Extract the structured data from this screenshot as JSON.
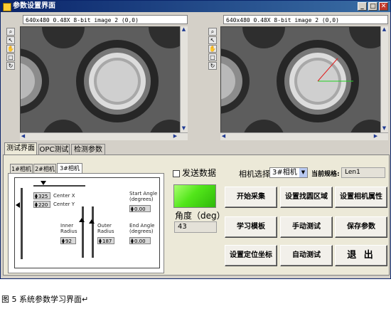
{
  "window": {
    "title": "参数设置界面",
    "controls": [
      "_",
      "□",
      "✕"
    ]
  },
  "left_image": {
    "info": "640x480 0.48X 8-bit image 2     (0,0)"
  },
  "right_image": {
    "info": "640x480 0.48X 8-bit image 2     (0,0)"
  },
  "main_tabs": [
    {
      "label": "测试界面"
    },
    {
      "label": "OPC测试"
    },
    {
      "label": "检测参数"
    }
  ],
  "camera_tabs": [
    {
      "label": "1#相机"
    },
    {
      "label": "2#相机"
    },
    {
      "label": "3#相机"
    }
  ],
  "roi": {
    "center_x_value": "325",
    "center_x_label": "Center X",
    "center_y_value": "220",
    "center_y_label": "Center Y",
    "start_angle_label_1": "Start Angle",
    "start_angle_label_2": "(degrees)",
    "start_angle_value": "0.00",
    "inner_radius_label_1": "Inner",
    "inner_radius_label_2": "Radius",
    "inner_radius_value": "92",
    "outer_radius_label_1": "Outer",
    "outer_radius_label_2": "Radius",
    "outer_radius_value": "187",
    "end_angle_label_1": "End Angle",
    "end_angle_label_2": "(degrees)",
    "end_angle_value": "0.00"
  },
  "send_data_checkbox": {
    "label": "发送数据",
    "checked": false
  },
  "status_led": {
    "color": "#4fdc1a"
  },
  "angle": {
    "label": "角度（deg）",
    "value": "43"
  },
  "camera_select": {
    "label": "相机选择",
    "value": "3#相机"
  },
  "current_spec": {
    "label": "当前规格:",
    "value": "Len1"
  },
  "buttons": {
    "start_capture": "开始采集",
    "set_search_region": "设置找圆区域",
    "set_camera_props": "设置相机属性",
    "learn_template": "学习模板",
    "manual_test": "手动测试",
    "save_params": "保存参数",
    "set_position_coords": "设置定位坐标",
    "auto_test": "自动测试",
    "exit": "退 出"
  },
  "caption": "图 5  系统参数学习界面↵"
}
